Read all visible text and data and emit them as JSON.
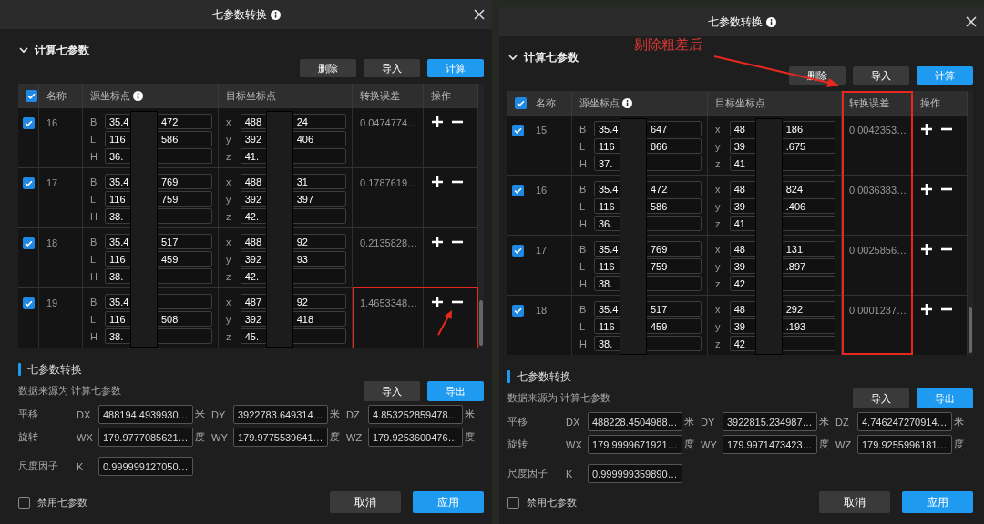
{
  "panels": [
    {
      "title": "七参数转换",
      "section": {
        "title": "计算七参数",
        "expanded": true
      },
      "toolbar": [
        {
          "label": "删除",
          "primary": false
        },
        {
          "label": "导入",
          "primary": false
        },
        {
          "label": "计算",
          "primary": true
        }
      ],
      "table": {
        "all_checked": true,
        "columns": [
          {
            "label": "名称",
            "info": false,
            "highlighted": false
          },
          {
            "label": "源坐标点",
            "info": true,
            "highlighted": false
          },
          {
            "label": "目标坐标点",
            "info": false,
            "highlighted": false
          },
          {
            "label": "转换误差",
            "info": false,
            "highlighted": false
          },
          {
            "label": "操作",
            "info": false,
            "highlighted": false
          }
        ],
        "rows": [
          {
            "name": "16",
            "checked": true,
            "highlighted": false,
            "source": [
              {
                "axis": "B",
                "head": "35.4",
                "tail": "472"
              },
              {
                "axis": "L",
                "head": "116",
                "tail": "586"
              },
              {
                "axis": "H",
                "head": "36."
              }
            ],
            "target": [
              {
                "axis": "x",
                "head": "488",
                "tail": "24"
              },
              {
                "axis": "y",
                "head": "392",
                "tail": "406"
              },
              {
                "axis": "z",
                "head": "41."
              }
            ],
            "error": "0.0474774…"
          },
          {
            "name": "17",
            "checked": true,
            "highlighted": false,
            "source": [
              {
                "axis": "B",
                "head": "35.4",
                "tail": "769"
              },
              {
                "axis": "L",
                "head": "116",
                "tail": "759"
              },
              {
                "axis": "H",
                "head": "38."
              }
            ],
            "target": [
              {
                "axis": "x",
                "head": "488",
                "tail": "31"
              },
              {
                "axis": "y",
                "head": "392",
                "tail": "397"
              },
              {
                "axis": "z",
                "head": "42."
              }
            ],
            "error": "0.1787619…"
          },
          {
            "name": "18",
            "checked": true,
            "highlighted": false,
            "source": [
              {
                "axis": "B",
                "head": "35.4",
                "tail": "517"
              },
              {
                "axis": "L",
                "head": "116",
                "tail": "459"
              },
              {
                "axis": "H",
                "head": "38."
              }
            ],
            "target": [
              {
                "axis": "x",
                "head": "488",
                "tail": "92"
              },
              {
                "axis": "y",
                "head": "392",
                "tail": "93"
              },
              {
                "axis": "z",
                "head": "42."
              }
            ],
            "error": "0.2135828…"
          },
          {
            "name": "19",
            "checked": true,
            "highlighted": true,
            "source": [
              {
                "axis": "B",
                "head": "35.4"
              },
              {
                "axis": "L",
                "head": "116",
                "tail": "508"
              },
              {
                "axis": "H",
                "head": "38."
              }
            ],
            "target": [
              {
                "axis": "x",
                "head": "487",
                "tail": "92"
              },
              {
                "axis": "y",
                "head": "392",
                "tail": "418"
              },
              {
                "axis": "z",
                "head": "45."
              }
            ],
            "error": "1.4653348…"
          }
        ]
      },
      "transform": {
        "title": "七参数转换",
        "source_note": "数据来源为 计算七参数",
        "buttons": [
          {
            "label": "导入",
            "primary": false
          },
          {
            "label": "导出",
            "primary": true
          }
        ],
        "params": [
          {
            "label": "平移",
            "fields": [
              {
                "axis": "DX",
                "value": "488194.4939930…",
                "unit": "米"
              },
              {
                "axis": "DY",
                "value": "3922783.649314…",
                "unit": "米"
              },
              {
                "axis": "DZ",
                "value": "4.853252859478…",
                "unit": "米"
              }
            ]
          },
          {
            "label": "旋转",
            "fields": [
              {
                "axis": "WX",
                "value": "179.9777085621…",
                "unit": "度"
              },
              {
                "axis": "WY",
                "value": "179.9775539641…",
                "unit": "度"
              },
              {
                "axis": "WZ",
                "value": "179.9253600476…",
                "unit": "度"
              }
            ]
          },
          {
            "label": "尺度因子",
            "fields": [
              {
                "axis": "K",
                "value": "0.999999127050…"
              }
            ]
          }
        ]
      },
      "footer": {
        "disable": {
          "label": "禁用七参数",
          "checked": false
        },
        "buttons": [
          {
            "label": "取消",
            "primary": false
          },
          {
            "label": "应用",
            "primary": true
          }
        ]
      }
    },
    {
      "title": "七参数转换",
      "annotation": {
        "text": "剔除粗差后"
      },
      "section": {
        "title": "计算七参数",
        "expanded": true
      },
      "toolbar": [
        {
          "label": "删除",
          "primary": false
        },
        {
          "label": "导入",
          "primary": false
        },
        {
          "label": "计算",
          "primary": true
        }
      ],
      "table": {
        "all_checked": true,
        "columns": [
          {
            "label": "名称",
            "info": false,
            "highlighted": false
          },
          {
            "label": "源坐标点",
            "info": true,
            "highlighted": false
          },
          {
            "label": "目标坐标点",
            "info": false,
            "highlighted": false
          },
          {
            "label": "转换误差",
            "info": false,
            "highlighted": true
          },
          {
            "label": "操作",
            "info": false,
            "highlighted": false
          }
        ],
        "rows": [
          {
            "name": "15",
            "checked": true,
            "highlighted": false,
            "source": [
              {
                "axis": "B",
                "head": "35.4",
                "tail": "647"
              },
              {
                "axis": "L",
                "head": "116",
                "tail": "866"
              },
              {
                "axis": "H",
                "head": "37."
              }
            ],
            "target": [
              {
                "axis": "x",
                "head": "48",
                "tail": "186"
              },
              {
                "axis": "y",
                "head": "39",
                "tail": ".675"
              },
              {
                "axis": "z",
                "head": "41"
              }
            ],
            "error": "0.0042353…"
          },
          {
            "name": "16",
            "checked": true,
            "highlighted": false,
            "source": [
              {
                "axis": "B",
                "head": "35.4",
                "tail": "472"
              },
              {
                "axis": "L",
                "head": "116",
                "tail": "586"
              },
              {
                "axis": "H",
                "head": "36."
              }
            ],
            "target": [
              {
                "axis": "x",
                "head": "48",
                "tail": "824"
              },
              {
                "axis": "y",
                "head": "39",
                "tail": ".406"
              },
              {
                "axis": "z",
                "head": "41"
              }
            ],
            "error": "0.0036383…"
          },
          {
            "name": "17",
            "checked": true,
            "highlighted": false,
            "source": [
              {
                "axis": "B",
                "head": "35.4",
                "tail": "769"
              },
              {
                "axis": "L",
                "head": "116",
                "tail": "759"
              },
              {
                "axis": "H",
                "head": "38."
              }
            ],
            "target": [
              {
                "axis": "x",
                "head": "48",
                "tail": "131"
              },
              {
                "axis": "y",
                "head": "39",
                "tail": ".897"
              },
              {
                "axis": "z",
                "head": "42"
              }
            ],
            "error": "0.0025856…"
          },
          {
            "name": "18",
            "checked": true,
            "highlighted": false,
            "source": [
              {
                "axis": "B",
                "head": "35.4",
                "tail": "517"
              },
              {
                "axis": "L",
                "head": "116",
                "tail": "459"
              },
              {
                "axis": "H",
                "head": "38."
              }
            ],
            "target": [
              {
                "axis": "x",
                "head": "48",
                "tail": "292"
              },
              {
                "axis": "y",
                "head": "39",
                "tail": ".193"
              },
              {
                "axis": "z",
                "head": "42"
              }
            ],
            "error": "0.0001237…"
          }
        ]
      },
      "transform": {
        "title": "七参数转换",
        "source_note": "数据来源为 计算七参数",
        "buttons": [
          {
            "label": "导入",
            "primary": false
          },
          {
            "label": "导出",
            "primary": true
          }
        ],
        "params": [
          {
            "label": "平移",
            "fields": [
              {
                "axis": "DX",
                "value": "488228.4504988…",
                "unit": "米"
              },
              {
                "axis": "DY",
                "value": "3922815.234987…",
                "unit": "米"
              },
              {
                "axis": "DZ",
                "value": "4.746247270914…",
                "unit": "米"
              }
            ]
          },
          {
            "label": "旋转",
            "fields": [
              {
                "axis": "WX",
                "value": "179.9999671921…",
                "unit": "度"
              },
              {
                "axis": "WY",
                "value": "179.9971473423…",
                "unit": "度"
              },
              {
                "axis": "WZ",
                "value": "179.9255996181…",
                "unit": "度"
              }
            ]
          },
          {
            "label": "尺度因子",
            "fields": [
              {
                "axis": "K",
                "value": "0.999999359890…"
              }
            ]
          }
        ]
      },
      "footer": {
        "disable": {
          "label": "禁用七参数",
          "checked": false
        },
        "buttons": [
          {
            "label": "取消",
            "primary": false
          },
          {
            "label": "应用",
            "primary": true
          }
        ]
      }
    }
  ]
}
